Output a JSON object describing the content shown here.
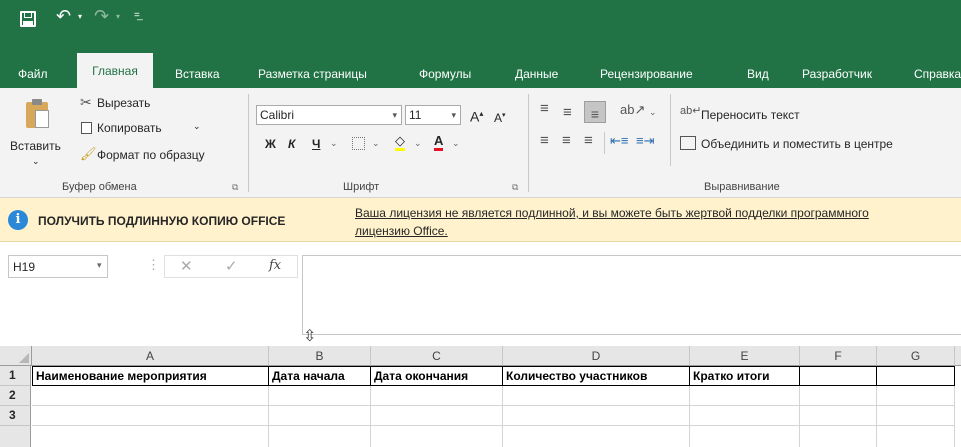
{
  "tabs": [
    "Файл",
    "Главная",
    "Вставка",
    "Разметка страницы",
    "Формулы",
    "Данные",
    "Рецензирование",
    "Вид",
    "Разработчик",
    "Справка"
  ],
  "clipboard": {
    "paste": "Вставить",
    "cut": "Вырезать",
    "copy": "Копировать",
    "format_painter": "Формат по образцу",
    "group": "Буфер обмена"
  },
  "font": {
    "name": "Calibri",
    "size": "11",
    "group": "Шрифт",
    "bold": "Ж",
    "italic": "К",
    "underline": "Ч"
  },
  "alignment": {
    "wrap": "Переносить текст",
    "merge": "Объединить и поместить в центре",
    "group": "Выравнивание"
  },
  "message": {
    "title": "ПОЛУЧИТЬ ПОДЛИННУЮ КОПИЮ OFFICE",
    "line1": "Ваша лицензия не является подлинной, и вы можете быть жертвой подделки программного",
    "line2": "лицензию Office."
  },
  "formula_bar": {
    "name_box": "H19",
    "fx": "fx",
    "content": ""
  },
  "columns": [
    "A",
    "B",
    "C",
    "D",
    "E",
    "F",
    "G"
  ],
  "rows": [
    "1",
    "2",
    "3"
  ],
  "headers": [
    "Наименование мероприятия",
    "Дата начала",
    "Дата окончания",
    "Количество участников",
    "Кратко итоги"
  ],
  "colors": {
    "accent": "#217346",
    "message_bg": "#fff2cc",
    "info_icon": "#2b88d8"
  }
}
